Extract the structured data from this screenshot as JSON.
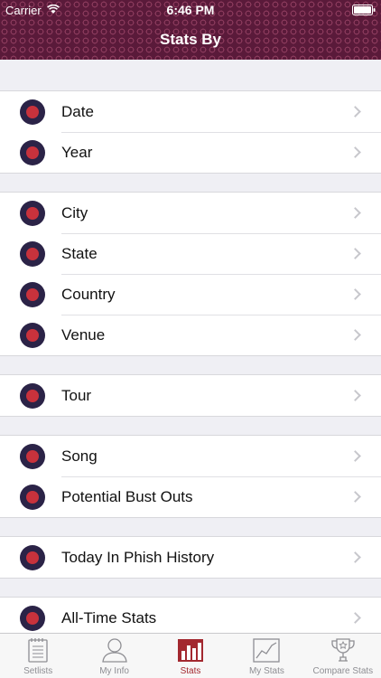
{
  "status": {
    "carrier": "Carrier",
    "time": "6:46 PM"
  },
  "nav": {
    "title": "Stats By"
  },
  "groups": [
    {
      "items": [
        {
          "label": "Date"
        },
        {
          "label": "Year"
        }
      ]
    },
    {
      "items": [
        {
          "label": "City"
        },
        {
          "label": "State"
        },
        {
          "label": "Country"
        },
        {
          "label": "Venue"
        }
      ]
    },
    {
      "items": [
        {
          "label": "Tour"
        }
      ]
    },
    {
      "items": [
        {
          "label": "Song"
        },
        {
          "label": "Potential Bust Outs"
        }
      ]
    },
    {
      "items": [
        {
          "label": "Today In Phish History"
        }
      ]
    },
    {
      "items": [
        {
          "label": "All-Time Stats"
        }
      ]
    }
  ],
  "tabs": [
    {
      "label": "Setlists",
      "icon": "setlist-icon"
    },
    {
      "label": "My Info",
      "icon": "person-icon"
    },
    {
      "label": "Stats",
      "icon": "bar-chart-icon",
      "active": true
    },
    {
      "label": "My Stats",
      "icon": "line-chart-icon"
    },
    {
      "label": "Compare Stats",
      "icon": "trophy-icon"
    }
  ],
  "colors": {
    "header": "#5a1a3a",
    "active_tab": "#a3282f",
    "icon_outer": "#2b2347",
    "icon_inner": "#c8323c"
  }
}
